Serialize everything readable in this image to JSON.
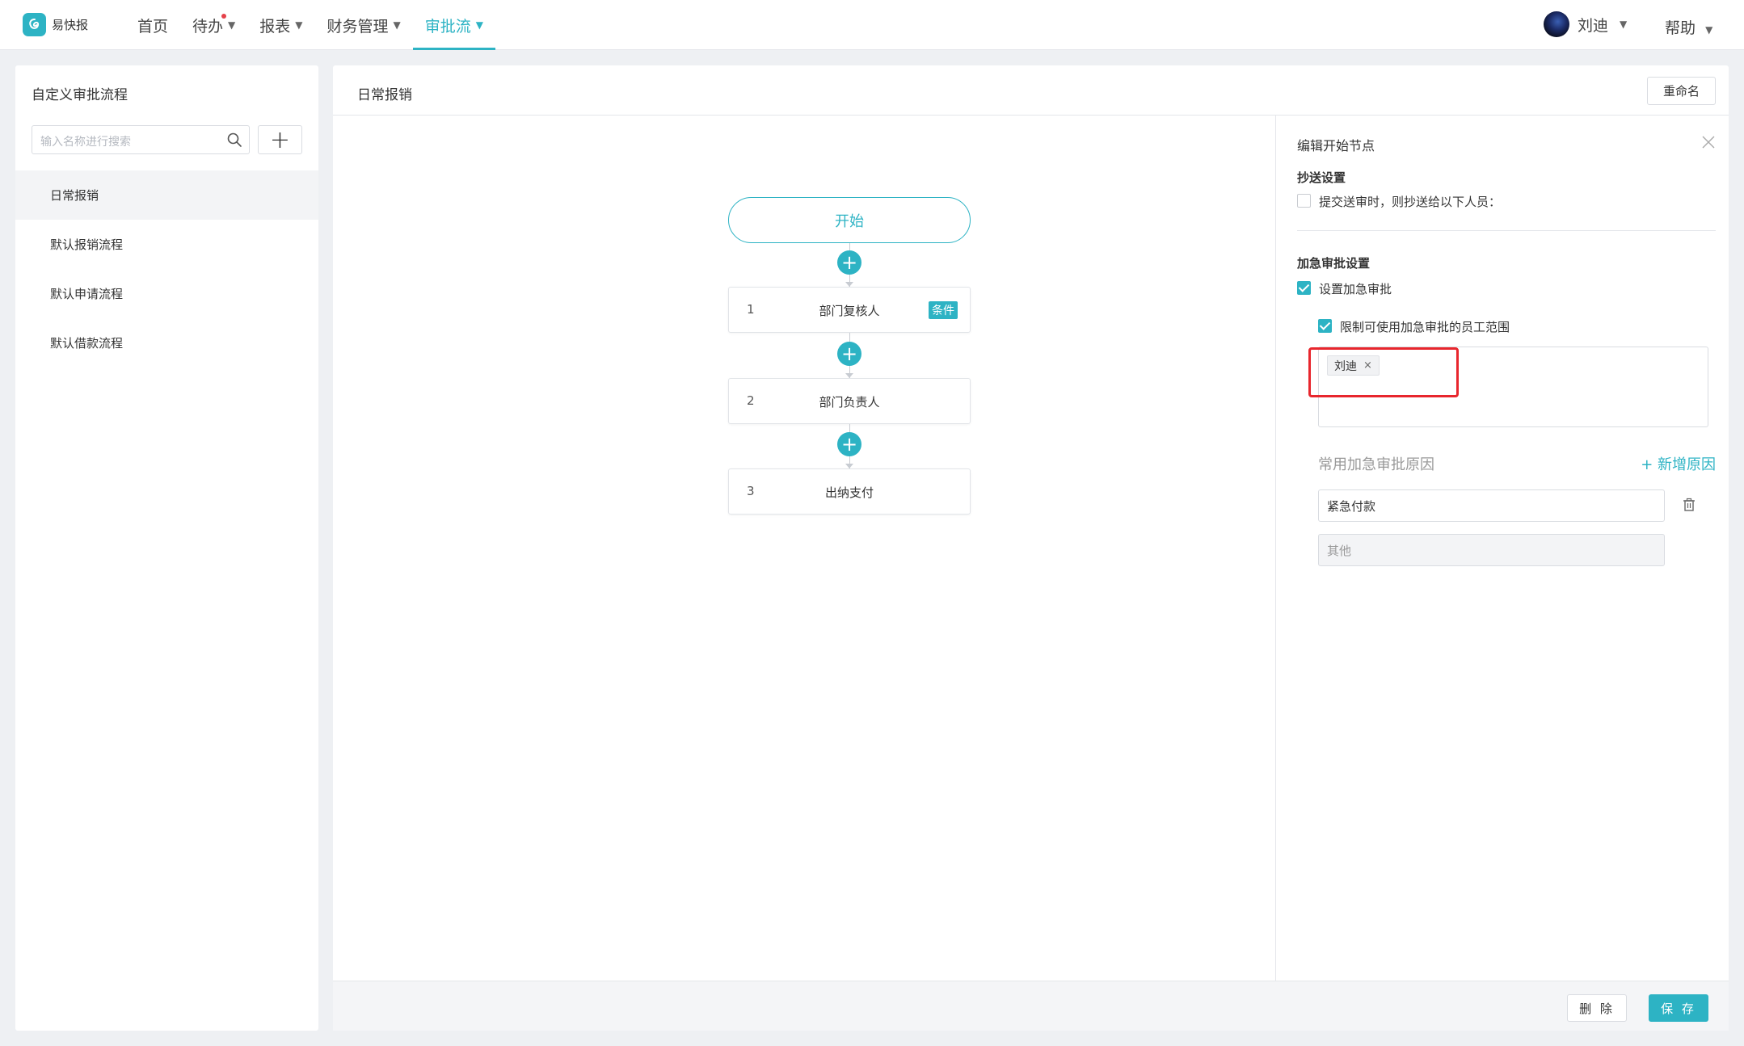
{
  "app": {
    "logo_text": "易快报"
  },
  "nav": {
    "items": [
      {
        "label": "首页",
        "dropdown": false,
        "active": false,
        "badge_dot": false
      },
      {
        "label": "待办",
        "dropdown": true,
        "active": false,
        "badge_dot": true
      },
      {
        "label": "报表",
        "dropdown": true,
        "active": false,
        "badge_dot": false
      },
      {
        "label": "财务管理",
        "dropdown": true,
        "active": false,
        "badge_dot": false
      },
      {
        "label": "审批流",
        "dropdown": true,
        "active": true,
        "badge_dot": false
      }
    ],
    "user_name": "刘迪",
    "help_label": "帮助"
  },
  "sidebar": {
    "title": "自定义审批流程",
    "search_placeholder": "输入名称进行搜索",
    "add_label": "+",
    "items": [
      {
        "label": "日常报销",
        "selected": true
      },
      {
        "label": "默认报销流程",
        "selected": false
      },
      {
        "label": "默认申请流程",
        "selected": false
      },
      {
        "label": "默认借款流程",
        "selected": false
      }
    ]
  },
  "main": {
    "title": "日常报销",
    "rename_label": "重命名",
    "flow": {
      "start_label": "开始",
      "steps": [
        {
          "num": "1",
          "label": "部门复核人",
          "badge": "条件"
        },
        {
          "num": "2",
          "label": "部门负责人",
          "badge": ""
        },
        {
          "num": "3",
          "label": "出纳支付",
          "badge": ""
        }
      ]
    },
    "editor": {
      "title": "编辑开始节点",
      "cc_section_title": "抄送设置",
      "cc_checkbox_label": "提交送审时，则抄送给以下人员：",
      "cc_checked": false,
      "urgent_section_title": "加急审批设置",
      "urgent_checkbox_label": "设置加急审批",
      "urgent_checked": true,
      "limit_checkbox_label": "限制可使用加急审批的员工范围",
      "limit_checked": true,
      "selected_staff": [
        "刘迪"
      ],
      "reasons_title": "常用加急审批原因",
      "add_reason_label": "+ 新增原因",
      "reasons": [
        {
          "value": "紧急付款",
          "disabled": false
        },
        {
          "value": "其他",
          "disabled": true
        }
      ]
    },
    "footer": {
      "delete_label": "删 除",
      "save_label": "保 存"
    }
  },
  "colors": {
    "accent": "#2db3c4",
    "highlight_box": "#e8262d",
    "notification_dot": "#e5414a"
  }
}
